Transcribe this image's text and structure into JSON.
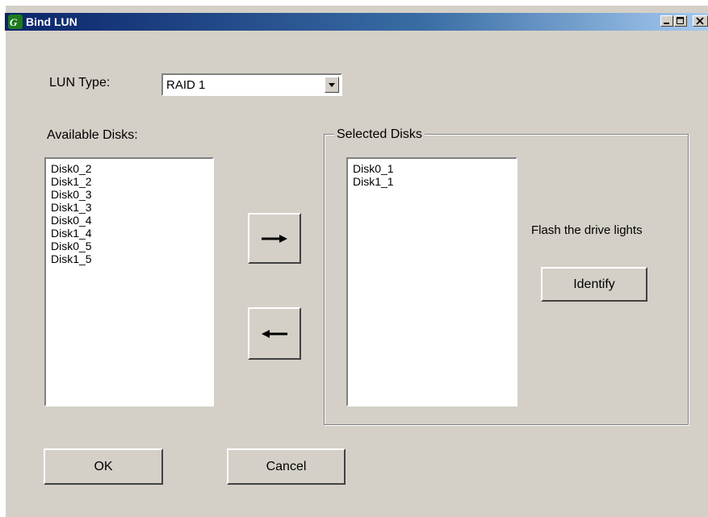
{
  "window": {
    "title": "Bind LUN"
  },
  "lun_type": {
    "label": "LUN Type:",
    "selected": "RAID 1"
  },
  "available": {
    "label": "Available Disks:",
    "items": [
      "Disk0_2",
      "Disk1_2",
      "Disk0_3",
      "Disk1_3",
      "Disk0_4",
      "Disk1_4",
      "Disk0_5",
      "Disk1_5"
    ]
  },
  "selected": {
    "label": "Selected Disks",
    "items": [
      "Disk0_1",
      "Disk1_1"
    ]
  },
  "identify": {
    "caption": "Flash the drive lights",
    "button": "Identify"
  },
  "footer": {
    "ok": "OK",
    "cancel": "Cancel"
  }
}
